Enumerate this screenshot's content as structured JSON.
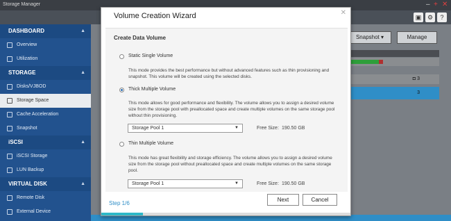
{
  "window": {
    "title": "Storage Manager",
    "minimize_glyph": "–",
    "maximize_glyph": "+",
    "close_glyph": "✕"
  },
  "toolbar": {
    "icons": [
      "puzzle-icon",
      "gear-icon",
      "help-icon"
    ],
    "icon_glyphs": [
      "▣",
      "⚙",
      "?"
    ]
  },
  "sidebar": {
    "sections": [
      {
        "label": "DASHBOARD",
        "items": [
          "Overview",
          "Utilization"
        ]
      },
      {
        "label": "STORAGE",
        "items": [
          "Disks/VJBOD",
          "Storage Space",
          "Cache Acceleration",
          "Snapshot"
        ]
      },
      {
        "label": "iSCSI",
        "items": [
          "iSCSI Storage",
          "LUN Backup"
        ]
      },
      {
        "label": "VIRTUAL DISK",
        "items": [
          "Remote Disk",
          "External Device"
        ]
      }
    ],
    "active_item": "Storage Space",
    "chevron_glyph": "▲"
  },
  "background": {
    "snapshot_label": "Snapshot ▾",
    "manage_label": "Manage",
    "row_count_a": "3",
    "row_count_b": "3",
    "row_icon": "◘"
  },
  "dialog": {
    "title": "Volume Creation Wizard",
    "close_glyph": "✕",
    "section_title": "Create Data Volume",
    "options": [
      {
        "label": "Static Single Volume",
        "checked": false,
        "description": "This mode provides the best performance but without advanced features such as thin provisioning and snapshot. This volume will be created using the selected disks."
      },
      {
        "label": "Thick Multiple Volume",
        "checked": true,
        "description": "This mode allows for good performance and flexibility. The volume allows you to assign a desired volume size from the storage pool with preallocated space and create multiple volumes on the same storage pool without thin provisioning.",
        "pool": "Storage Pool 1",
        "free_size_label": "Free Size:",
        "free_size_value": "190.50 GB"
      },
      {
        "label": "Thin Multiple Volume",
        "checked": false,
        "description": "This mode has great flexibility and storage efficiency. The volume allows you to assign a desired volume size from the storage pool without preallocated space and create multiple volumes on the same storage pool.",
        "pool": "Storage Pool 1",
        "free_size_label": "Free Size:",
        "free_size_value": "190.50 GB"
      }
    ],
    "select_caret_glyph": "▼",
    "step": "Step 1/6",
    "progress": 0.167,
    "next_label": "Next",
    "cancel_label": "Cancel"
  },
  "colors": {
    "accent": "#2f8ec7",
    "sidebar": "#22528e",
    "progress": "#2fb8c8"
  }
}
